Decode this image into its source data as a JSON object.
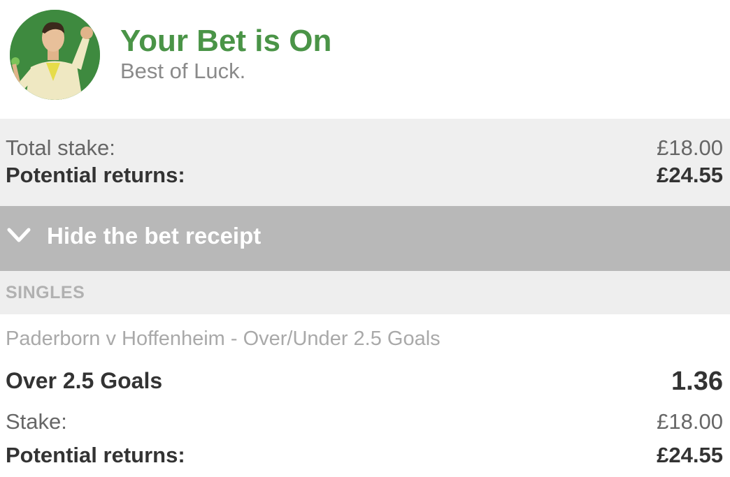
{
  "header": {
    "title": "Your Bet is On",
    "subtitle": "Best of Luck.",
    "avatar_icon": "cheering-man-avatar",
    "title_color": "#4a9447"
  },
  "summary": {
    "total_stake_label": "Total stake:",
    "total_stake_value": "£18.00",
    "potential_returns_label": "Potential returns:",
    "potential_returns_value": "£24.55"
  },
  "receipt_toggle": {
    "icon": "chevron-down-icon",
    "label": "Hide the bet receipt"
  },
  "section": {
    "label": "SINGLES"
  },
  "bet": {
    "event": "Paderborn v Hoffenheim - Over/Under 2.5 Goals",
    "selection": "Over 2.5 Goals",
    "odds": "1.36",
    "stake_label": "Stake:",
    "stake_value": "£18.00",
    "potential_returns_label": "Potential returns:",
    "potential_returns_value": "£24.55"
  }
}
